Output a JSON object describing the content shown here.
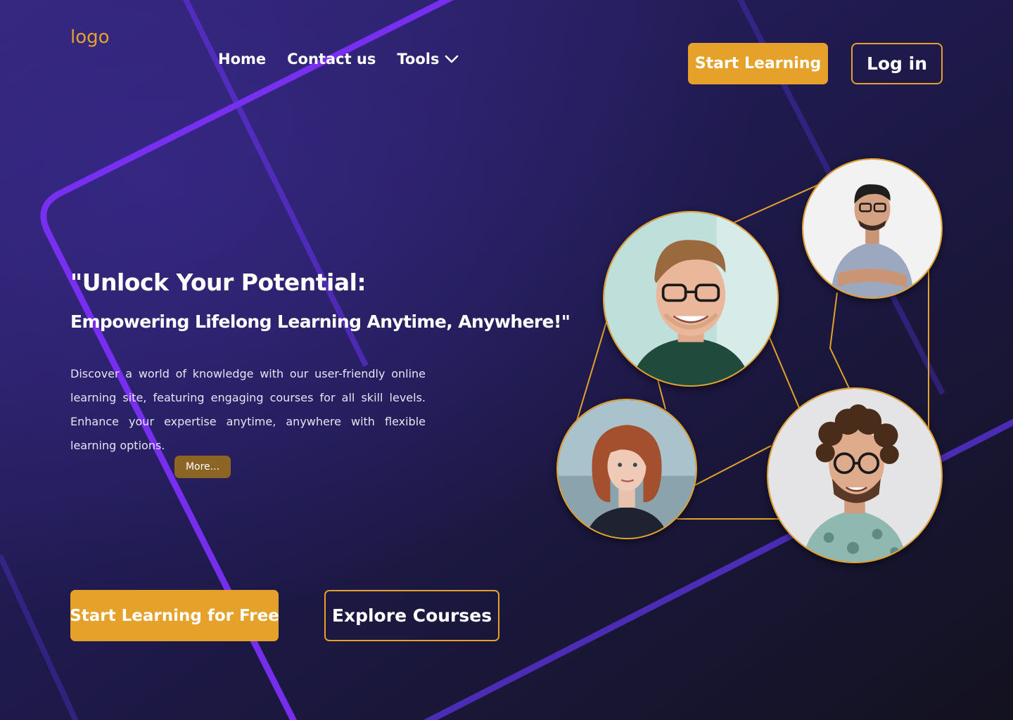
{
  "header": {
    "logo": "logo",
    "nav": {
      "home": "Home",
      "contact": "Contact us",
      "tools": "Tools"
    },
    "start_learning": "Start Learning",
    "login": "Log in"
  },
  "hero": {
    "headline": "\"Unlock Your Potential:",
    "subheadline": "Empowering Lifelong Learning Anytime, Anywhere!\"",
    "description": "Discover a world of knowledge with our user-friendly online learning site, featuring engaging courses for all skill levels. Enhance your expertise anytime, anywhere with flexible learning options.",
    "more": "More...",
    "cta_primary": "Start Learning for Free",
    "cta_secondary": "Explore Courses"
  },
  "colors": {
    "accent": "#E5A12A",
    "background_dark": "#16142c",
    "background_purple": "#2e2470",
    "line_purple": "#7B2FF7"
  },
  "icons": {
    "tools_dropdown": "chevron-down-icon"
  },
  "avatars": [
    {
      "name": "avatar-man-glasses-green-shirt"
    },
    {
      "name": "avatar-man-crossed-arms"
    },
    {
      "name": "avatar-woman-red-hair"
    },
    {
      "name": "avatar-man-curly-hair"
    }
  ]
}
